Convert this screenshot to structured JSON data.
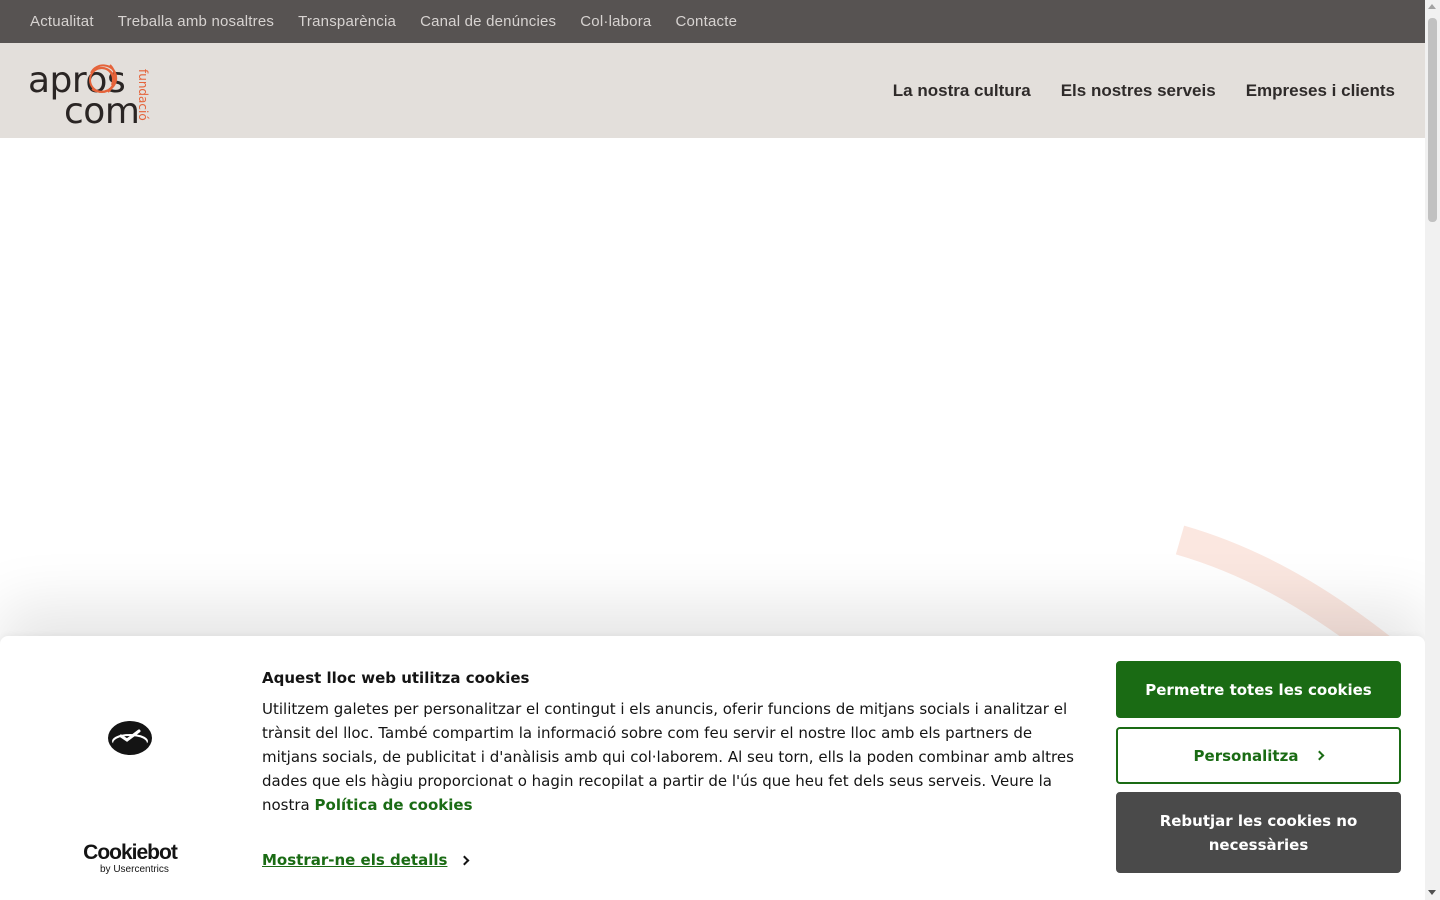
{
  "topbar": {
    "links": [
      "Actualitat",
      "Treballa amb nosaltres",
      "Transparència",
      "Canal de denúncies",
      "Col·labora",
      "Contacte"
    ]
  },
  "header": {
    "logo": {
      "line1": "apros",
      "line2": "com",
      "side": "fundació",
      "color": "#e5633a"
    },
    "nav": [
      "La nostra cultura",
      "Els nostres serveis",
      "Empreses i clients"
    ]
  },
  "cookie_banner": {
    "title": "Aquest lloc web utilitza cookies",
    "body": "Utilitzem galetes per personalitzar el contingut i els anuncis, oferir funcions de mitjans socials i analitzar el trànsit del lloc. També compartim la informació sobre com feu servir el nostre lloc amb els partners de mitjans socials, de publicitat i d'anàlisis amb qui col·laborem. Al seu torn, ells la poden combinar amb altres dades que els hàgiu proporcionat o hagin recopilat a partir de l'ús que heu fet dels seus serveis. Veure la nostra",
    "policy_link": "Política de cookies",
    "details_link": "Mostrar-ne els detalls",
    "allow_all": "Permetre totes les cookies",
    "customize": "Personalitza",
    "deny": "Rebutjar les cookies no necessàries",
    "brand": {
      "name": "Cookiebot",
      "sub": "by Usercentrics"
    },
    "accent_color": "#1a6b14"
  }
}
